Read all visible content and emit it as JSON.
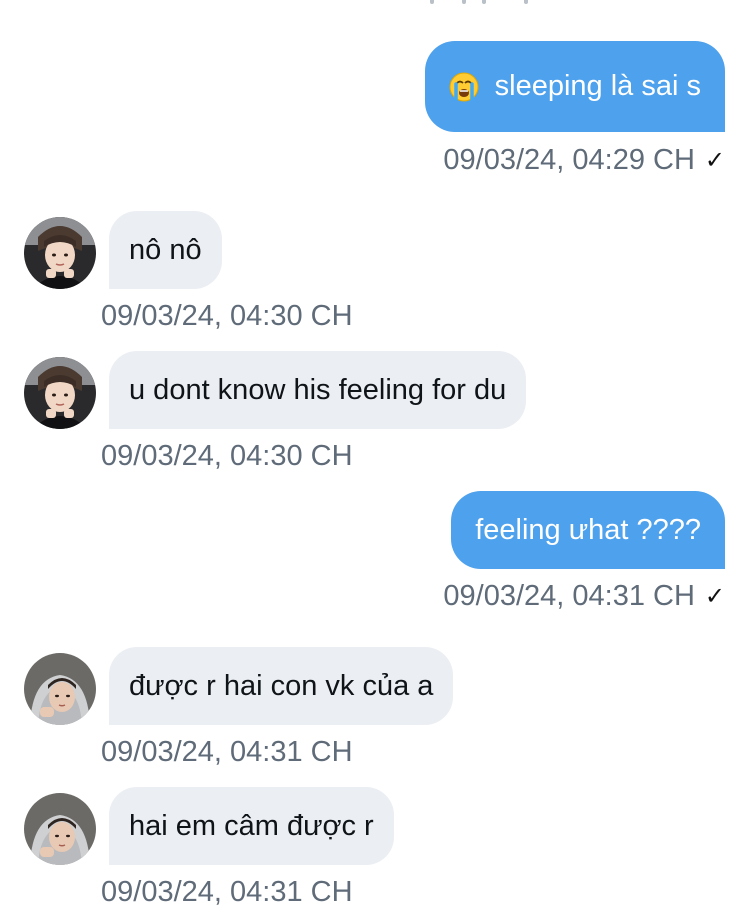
{
  "messages": [
    {
      "direction": "outgoing",
      "text": "sleeping là sai s",
      "emoji": "loudly-crying-face",
      "timestamp": "09/03/24, 04:29 CH",
      "read_mark": "✓"
    },
    {
      "direction": "incoming",
      "text": "nô nô",
      "timestamp": "09/03/24, 04:30 CH",
      "avatar": "user-a"
    },
    {
      "direction": "incoming",
      "text": "u dont know his feeling for du",
      "timestamp": "09/03/24, 04:30 CH",
      "avatar": "user-a"
    },
    {
      "direction": "outgoing",
      "text": "feeling ưhat ????",
      "timestamp": "09/03/24, 04:31 CH",
      "read_mark": "✓"
    },
    {
      "direction": "incoming",
      "text": "được r hai con vk của a",
      "timestamp": "09/03/24, 04:31 CH",
      "avatar": "user-b"
    },
    {
      "direction": "incoming",
      "text": "hai em câm được r",
      "timestamp": "09/03/24, 04:31 CH",
      "avatar": "user-b"
    }
  ],
  "colors": {
    "outgoing_bubble": "#4ea1ec",
    "incoming_bubble": "#ebeef2",
    "timestamp": "#5f6b78",
    "background": "#ffffff"
  }
}
